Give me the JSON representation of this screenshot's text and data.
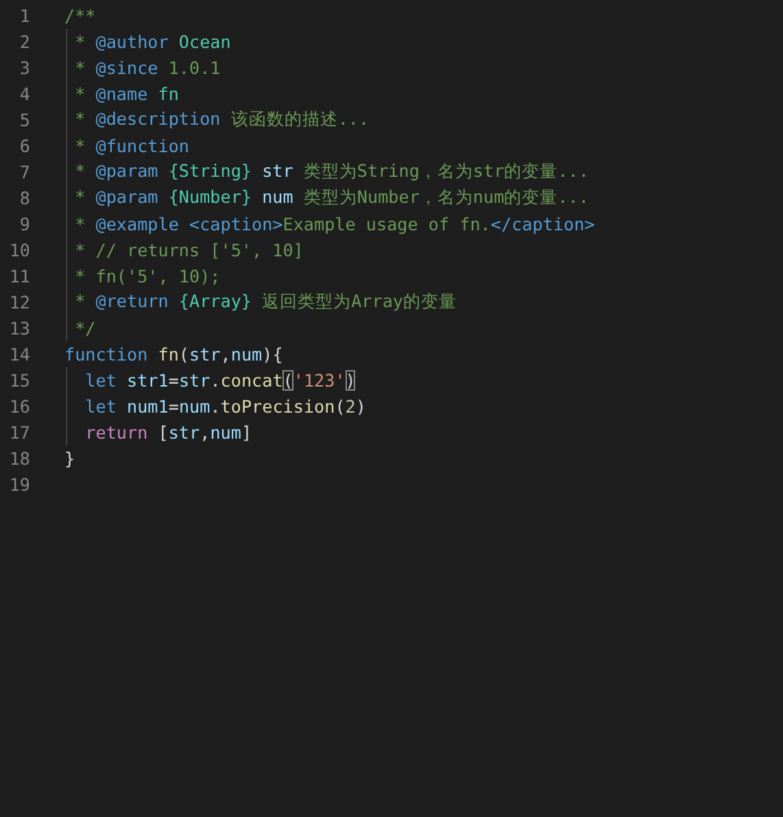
{
  "editor": {
    "lines": [
      {
        "number": "1",
        "tokens": [
          {
            "kind": "comment",
            "text": "/**"
          }
        ]
      },
      {
        "number": "2",
        "tokens": [
          {
            "kind": "comment",
            "text": " * "
          },
          {
            "kind": "tag",
            "text": "@author"
          },
          {
            "kind": "type",
            "text": " Ocean"
          }
        ]
      },
      {
        "number": "3",
        "tokens": [
          {
            "kind": "comment",
            "text": " * "
          },
          {
            "kind": "tag",
            "text": "@since"
          },
          {
            "kind": "comment",
            "text": " 1.0.1"
          }
        ]
      },
      {
        "number": "4",
        "tokens": [
          {
            "kind": "comment",
            "text": " * "
          },
          {
            "kind": "tag",
            "text": "@name"
          },
          {
            "kind": "type",
            "text": " fn"
          }
        ]
      },
      {
        "number": "5",
        "tokens": [
          {
            "kind": "comment",
            "text": " * "
          },
          {
            "kind": "tag",
            "text": "@description"
          },
          {
            "kind": "comment",
            "text": " 该函数的描述..."
          }
        ]
      },
      {
        "number": "6",
        "tokens": [
          {
            "kind": "comment",
            "text": " * "
          },
          {
            "kind": "tag",
            "text": "@function"
          }
        ]
      },
      {
        "number": "7",
        "tokens": [
          {
            "kind": "comment",
            "text": " * "
          },
          {
            "kind": "tag",
            "text": "@param"
          },
          {
            "kind": "type",
            "text": " {String}"
          },
          {
            "kind": "variable",
            "text": " str"
          },
          {
            "kind": "comment",
            "text": " 类型为String，名为str的变量..."
          }
        ]
      },
      {
        "number": "8",
        "tokens": [
          {
            "kind": "comment",
            "text": " * "
          },
          {
            "kind": "tag",
            "text": "@param"
          },
          {
            "kind": "type",
            "text": " {Number}"
          },
          {
            "kind": "variable",
            "text": " num"
          },
          {
            "kind": "comment",
            "text": " 类型为Number，名为num的变量..."
          }
        ]
      },
      {
        "number": "9",
        "tokens": [
          {
            "kind": "comment",
            "text": " * "
          },
          {
            "kind": "tag",
            "text": "@example"
          },
          {
            "kind": "tag",
            "text": " <caption>"
          },
          {
            "kind": "comment",
            "text": "Example usage of fn."
          },
          {
            "kind": "tag",
            "text": "</caption>"
          }
        ]
      },
      {
        "number": "10",
        "tokens": [
          {
            "kind": "comment",
            "text": " * // returns ['5', 10]"
          }
        ]
      },
      {
        "number": "11",
        "tokens": [
          {
            "kind": "comment",
            "text": " * fn('5', 10);"
          }
        ]
      },
      {
        "number": "12",
        "tokens": [
          {
            "kind": "comment",
            "text": " * "
          },
          {
            "kind": "tag",
            "text": "@return"
          },
          {
            "kind": "type",
            "text": " {Array}"
          },
          {
            "kind": "comment",
            "text": " 返回类型为Array的变量"
          }
        ]
      },
      {
        "number": "13",
        "tokens": [
          {
            "kind": "comment",
            "text": " */"
          }
        ]
      },
      {
        "number": "14",
        "tokens": [
          {
            "kind": "keyword",
            "text": "function"
          },
          {
            "kind": "function",
            "text": " fn"
          },
          {
            "kind": "plain",
            "text": "("
          },
          {
            "kind": "variable",
            "text": "str"
          },
          {
            "kind": "plain",
            "text": ","
          },
          {
            "kind": "variable",
            "text": "num"
          },
          {
            "kind": "plain",
            "text": "){"
          }
        ]
      },
      {
        "number": "15",
        "tokens": [
          {
            "kind": "keyword",
            "text": "  let"
          },
          {
            "kind": "variable",
            "text": " str1"
          },
          {
            "kind": "plain",
            "text": "="
          },
          {
            "kind": "variable",
            "text": "str"
          },
          {
            "kind": "plain",
            "text": "."
          },
          {
            "kind": "function",
            "text": "concat"
          },
          {
            "kind": "bracket-match",
            "text": "("
          },
          {
            "kind": "string",
            "text": "'123'"
          },
          {
            "kind": "bracket-match",
            "text": ")"
          }
        ]
      },
      {
        "number": "16",
        "tokens": [
          {
            "kind": "keyword",
            "text": "  let"
          },
          {
            "kind": "variable",
            "text": " num1"
          },
          {
            "kind": "plain",
            "text": "="
          },
          {
            "kind": "variable",
            "text": "num"
          },
          {
            "kind": "plain",
            "text": "."
          },
          {
            "kind": "function",
            "text": "toPrecision"
          },
          {
            "kind": "plain",
            "text": "("
          },
          {
            "kind": "number",
            "text": "2"
          },
          {
            "kind": "plain",
            "text": ")"
          }
        ]
      },
      {
        "number": "17",
        "tokens": [
          {
            "kind": "control",
            "text": "  return"
          },
          {
            "kind": "plain",
            "text": " ["
          },
          {
            "kind": "variable",
            "text": "str"
          },
          {
            "kind": "plain",
            "text": ","
          },
          {
            "kind": "variable",
            "text": "num"
          },
          {
            "kind": "plain",
            "text": "]"
          }
        ]
      },
      {
        "number": "18",
        "tokens": [
          {
            "kind": "plain",
            "text": "}"
          }
        ]
      },
      {
        "number": "19"
      }
    ]
  }
}
